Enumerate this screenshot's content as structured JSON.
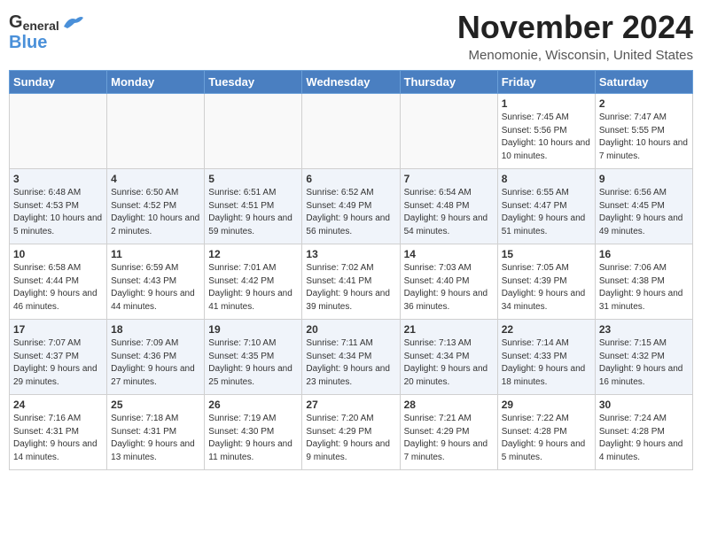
{
  "header": {
    "logo_top": "General",
    "logo_bottom": "Blue",
    "month": "November 2024",
    "location": "Menomonie, Wisconsin, United States"
  },
  "weekdays": [
    "Sunday",
    "Monday",
    "Tuesday",
    "Wednesday",
    "Thursday",
    "Friday",
    "Saturday"
  ],
  "weeks": [
    [
      {
        "day": "",
        "info": ""
      },
      {
        "day": "",
        "info": ""
      },
      {
        "day": "",
        "info": ""
      },
      {
        "day": "",
        "info": ""
      },
      {
        "day": "",
        "info": ""
      },
      {
        "day": "1",
        "info": "Sunrise: 7:45 AM\nSunset: 5:56 PM\nDaylight: 10 hours and 10 minutes."
      },
      {
        "day": "2",
        "info": "Sunrise: 7:47 AM\nSunset: 5:55 PM\nDaylight: 10 hours and 7 minutes."
      }
    ],
    [
      {
        "day": "3",
        "info": "Sunrise: 6:48 AM\nSunset: 4:53 PM\nDaylight: 10 hours and 5 minutes."
      },
      {
        "day": "4",
        "info": "Sunrise: 6:50 AM\nSunset: 4:52 PM\nDaylight: 10 hours and 2 minutes."
      },
      {
        "day": "5",
        "info": "Sunrise: 6:51 AM\nSunset: 4:51 PM\nDaylight: 9 hours and 59 minutes."
      },
      {
        "day": "6",
        "info": "Sunrise: 6:52 AM\nSunset: 4:49 PM\nDaylight: 9 hours and 56 minutes."
      },
      {
        "day": "7",
        "info": "Sunrise: 6:54 AM\nSunset: 4:48 PM\nDaylight: 9 hours and 54 minutes."
      },
      {
        "day": "8",
        "info": "Sunrise: 6:55 AM\nSunset: 4:47 PM\nDaylight: 9 hours and 51 minutes."
      },
      {
        "day": "9",
        "info": "Sunrise: 6:56 AM\nSunset: 4:45 PM\nDaylight: 9 hours and 49 minutes."
      }
    ],
    [
      {
        "day": "10",
        "info": "Sunrise: 6:58 AM\nSunset: 4:44 PM\nDaylight: 9 hours and 46 minutes."
      },
      {
        "day": "11",
        "info": "Sunrise: 6:59 AM\nSunset: 4:43 PM\nDaylight: 9 hours and 44 minutes."
      },
      {
        "day": "12",
        "info": "Sunrise: 7:01 AM\nSunset: 4:42 PM\nDaylight: 9 hours and 41 minutes."
      },
      {
        "day": "13",
        "info": "Sunrise: 7:02 AM\nSunset: 4:41 PM\nDaylight: 9 hours and 39 minutes."
      },
      {
        "day": "14",
        "info": "Sunrise: 7:03 AM\nSunset: 4:40 PM\nDaylight: 9 hours and 36 minutes."
      },
      {
        "day": "15",
        "info": "Sunrise: 7:05 AM\nSunset: 4:39 PM\nDaylight: 9 hours and 34 minutes."
      },
      {
        "day": "16",
        "info": "Sunrise: 7:06 AM\nSunset: 4:38 PM\nDaylight: 9 hours and 31 minutes."
      }
    ],
    [
      {
        "day": "17",
        "info": "Sunrise: 7:07 AM\nSunset: 4:37 PM\nDaylight: 9 hours and 29 minutes."
      },
      {
        "day": "18",
        "info": "Sunrise: 7:09 AM\nSunset: 4:36 PM\nDaylight: 9 hours and 27 minutes."
      },
      {
        "day": "19",
        "info": "Sunrise: 7:10 AM\nSunset: 4:35 PM\nDaylight: 9 hours and 25 minutes."
      },
      {
        "day": "20",
        "info": "Sunrise: 7:11 AM\nSunset: 4:34 PM\nDaylight: 9 hours and 23 minutes."
      },
      {
        "day": "21",
        "info": "Sunrise: 7:13 AM\nSunset: 4:34 PM\nDaylight: 9 hours and 20 minutes."
      },
      {
        "day": "22",
        "info": "Sunrise: 7:14 AM\nSunset: 4:33 PM\nDaylight: 9 hours and 18 minutes."
      },
      {
        "day": "23",
        "info": "Sunrise: 7:15 AM\nSunset: 4:32 PM\nDaylight: 9 hours and 16 minutes."
      }
    ],
    [
      {
        "day": "24",
        "info": "Sunrise: 7:16 AM\nSunset: 4:31 PM\nDaylight: 9 hours and 14 minutes."
      },
      {
        "day": "25",
        "info": "Sunrise: 7:18 AM\nSunset: 4:31 PM\nDaylight: 9 hours and 13 minutes."
      },
      {
        "day": "26",
        "info": "Sunrise: 7:19 AM\nSunset: 4:30 PM\nDaylight: 9 hours and 11 minutes."
      },
      {
        "day": "27",
        "info": "Sunrise: 7:20 AM\nSunset: 4:29 PM\nDaylight: 9 hours and 9 minutes."
      },
      {
        "day": "28",
        "info": "Sunrise: 7:21 AM\nSunset: 4:29 PM\nDaylight: 9 hours and 7 minutes."
      },
      {
        "day": "29",
        "info": "Sunrise: 7:22 AM\nSunset: 4:28 PM\nDaylight: 9 hours and 5 minutes."
      },
      {
        "day": "30",
        "info": "Sunrise: 7:24 AM\nSunset: 4:28 PM\nDaylight: 9 hours and 4 minutes."
      }
    ]
  ]
}
